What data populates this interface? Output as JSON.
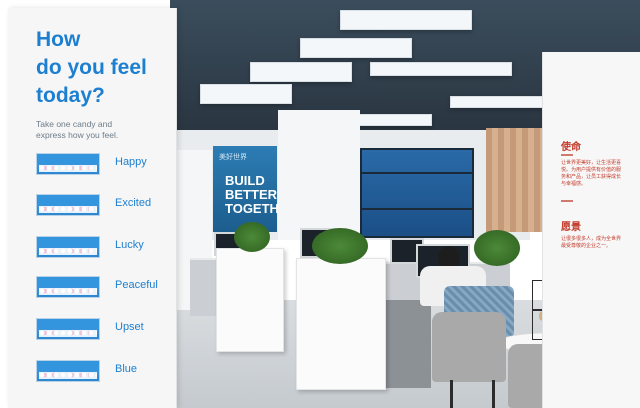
{
  "mood_board": {
    "title_lines": [
      "How",
      "do you feel",
      "today?"
    ],
    "subtitle_lines": [
      "Take one candy and",
      "express how you feel."
    ],
    "moods": [
      {
        "label": "Happy"
      },
      {
        "label": "Excited"
      },
      {
        "label": "Lucky"
      },
      {
        "label": "Peaceful"
      },
      {
        "label": "Upset"
      },
      {
        "label": "Blue"
      }
    ]
  },
  "back_banner": {
    "small_text": "美好世界",
    "line1": "BUILD",
    "line2": "BETTER",
    "line3": "TOGETH"
  },
  "right_board": {
    "heading_1": "使命",
    "text_1": "让世界更美好，让生活更喜悦。为用户提供有价值的服务和产品，让员工获得成长与幸福感。",
    "heading_2": "愿景",
    "text_2": "让很多很多人，成为全世界最受尊敬的企业之一。"
  },
  "colors": {
    "accent_blue": "#1d7fd0",
    "candy_box_blue": "#2d86d1",
    "board_red": "#c33c2c"
  }
}
